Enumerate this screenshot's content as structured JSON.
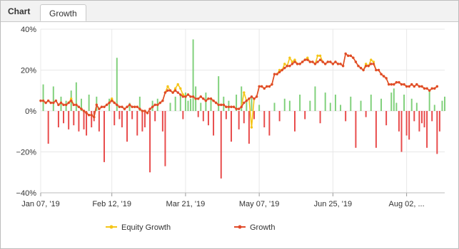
{
  "header": {
    "title": "Chart",
    "tabs": [
      {
        "label": "Growth",
        "active": true
      }
    ]
  },
  "colors": {
    "growth": "#e04a2a",
    "equity": "#f5c518",
    "profit_bar": "#7fd07a",
    "loss_bar": "#e84a4a",
    "grid": "#e8e8e8"
  },
  "chart_data": {
    "type": "line",
    "title": "",
    "xlabel": "",
    "ylabel": "",
    "x_ticks": [
      "Jan 07, '19",
      "Feb 12, '19",
      "Mar 21, '19",
      "May 07, '19",
      "Jun 25, '19",
      "Aug 02, ..."
    ],
    "y_ticks": [
      "40%",
      "20%",
      "0%",
      "−20%",
      "−40%"
    ],
    "ylim": [
      -40,
      40
    ],
    "x_unit": "trading day index",
    "xlim": [
      0,
      159
    ],
    "x_tick_positions": [
      0,
      28,
      57,
      86,
      115,
      144
    ],
    "legend": {
      "position": "bottom",
      "entries": [
        "Equity Growth",
        "Growth"
      ]
    },
    "series": [
      {
        "name": "Growth",
        "values": [
          5,
          5,
          4,
          5,
          4,
          4,
          5,
          3,
          4,
          3,
          3,
          4,
          5,
          3,
          3,
          2,
          1,
          0,
          -1,
          -2,
          -2,
          -3,
          3,
          1,
          2,
          2,
          3,
          4,
          5,
          4,
          3,
          2,
          2,
          1,
          2,
          3,
          2,
          2,
          2,
          1,
          0,
          0,
          -1,
          1,
          2,
          3,
          3,
          4,
          5,
          9,
          10,
          10,
          9,
          10,
          9,
          8,
          7,
          7,
          8,
          7,
          7,
          6,
          6,
          7,
          6,
          5,
          6,
          6,
          5,
          4,
          3,
          3,
          3,
          2,
          2,
          2,
          2,
          1,
          1,
          2,
          4,
          5,
          6,
          7,
          6,
          7,
          12,
          12,
          11,
          12,
          12,
          13,
          18,
          18,
          19,
          20,
          21,
          22,
          22,
          23,
          24,
          23,
          23,
          24,
          25,
          25,
          24,
          24,
          23,
          24,
          25,
          24,
          23,
          24,
          24,
          23,
          24,
          23,
          23,
          22,
          28,
          27,
          27,
          26,
          24,
          22,
          21,
          20,
          22,
          22,
          23,
          23,
          20,
          20,
          18,
          17,
          16,
          13,
          13,
          13,
          14,
          14,
          13,
          13,
          12,
          12,
          13,
          12,
          13,
          12,
          12,
          11,
          11,
          10,
          11,
          11,
          12
        ]
      },
      {
        "name": "Equity Growth",
        "values": [
          5,
          5,
          4,
          5,
          4,
          4,
          5,
          3,
          4,
          3,
          3,
          4,
          6,
          3,
          3,
          2,
          1,
          0,
          -1,
          -2,
          -2,
          -3,
          3,
          1,
          2,
          2,
          3,
          4,
          6,
          4,
          3,
          2,
          2,
          1,
          2,
          3,
          2,
          2,
          2,
          1,
          0,
          0,
          -1,
          1,
          2,
          3,
          3,
          4,
          5,
          9,
          12,
          10,
          9,
          11,
          13,
          11,
          8,
          7,
          8,
          7,
          7,
          6,
          6,
          7,
          6,
          5,
          6,
          6,
          5,
          4,
          3,
          3,
          3,
          2,
          2,
          2,
          2,
          1,
          1,
          2,
          9,
          5,
          6,
          -8,
          6,
          7,
          12,
          12,
          11,
          12,
          12,
          13,
          18,
          18,
          20,
          20,
          23,
          22,
          26,
          24,
          25,
          23,
          23,
          24,
          25,
          26,
          24,
          24,
          23,
          27,
          27,
          24,
          23,
          24,
          24,
          23,
          24,
          23,
          23,
          22,
          28,
          27,
          27,
          26,
          24,
          22,
          21,
          20,
          23,
          22,
          25,
          24,
          20,
          20,
          18,
          17,
          16,
          13,
          13,
          13,
          14,
          14,
          13,
          13,
          12,
          12,
          13,
          12,
          13,
          12,
          12,
          11,
          11,
          10,
          11,
          11,
          12
        ]
      }
    ],
    "bars": [
      {
        "x": 1,
        "value": 13
      },
      {
        "x": 3,
        "value": -16
      },
      {
        "x": 5,
        "value": 12
      },
      {
        "x": 7,
        "value": -8
      },
      {
        "x": 8,
        "value": 7
      },
      {
        "x": 9,
        "value": -6
      },
      {
        "x": 10,
        "value": 5
      },
      {
        "x": 11,
        "value": -9
      },
      {
        "x": 12,
        "value": 10
      },
      {
        "x": 13,
        "value": -7
      },
      {
        "x": 14,
        "value": 14
      },
      {
        "x": 15,
        "value": -10
      },
      {
        "x": 16,
        "value": 6
      },
      {
        "x": 17,
        "value": -9
      },
      {
        "x": 18,
        "value": -12
      },
      {
        "x": 19,
        "value": 8
      },
      {
        "x": 20,
        "value": -8
      },
      {
        "x": 21,
        "value": -5
      },
      {
        "x": 22,
        "value": 7
      },
      {
        "x": 23,
        "value": -10
      },
      {
        "x": 25,
        "value": -25
      },
      {
        "x": 27,
        "value": 6
      },
      {
        "x": 29,
        "value": -7
      },
      {
        "x": 30,
        "value": 26
      },
      {
        "x": 31,
        "value": -4
      },
      {
        "x": 32,
        "value": -8
      },
      {
        "x": 34,
        "value": -15
      },
      {
        "x": 35,
        "value": 4
      },
      {
        "x": 36,
        "value": -4
      },
      {
        "x": 38,
        "value": -12
      },
      {
        "x": 39,
        "value": 7
      },
      {
        "x": 40,
        "value": -10
      },
      {
        "x": 41,
        "value": -8
      },
      {
        "x": 43,
        "value": -30
      },
      {
        "x": 44,
        "value": 5
      },
      {
        "x": 45,
        "value": -5
      },
      {
        "x": 46,
        "value": 6
      },
      {
        "x": 48,
        "value": -10
      },
      {
        "x": 49,
        "value": -27
      },
      {
        "x": 51,
        "value": 4
      },
      {
        "x": 53,
        "value": 7
      },
      {
        "x": 55,
        "value": 8
      },
      {
        "x": 56,
        "value": -4
      },
      {
        "x": 57,
        "value": 9
      },
      {
        "x": 58,
        "value": 5
      },
      {
        "x": 59,
        "value": 6
      },
      {
        "x": 60,
        "value": 35
      },
      {
        "x": 61,
        "value": 12
      },
      {
        "x": 62,
        "value": -3
      },
      {
        "x": 63,
        "value": 4
      },
      {
        "x": 64,
        "value": -5
      },
      {
        "x": 65,
        "value": 9
      },
      {
        "x": 66,
        "value": -7
      },
      {
        "x": 67,
        "value": 6
      },
      {
        "x": 68,
        "value": -12
      },
      {
        "x": 70,
        "value": 17
      },
      {
        "x": 71,
        "value": -33
      },
      {
        "x": 72,
        "value": 7
      },
      {
        "x": 73,
        "value": -4
      },
      {
        "x": 74,
        "value": 5
      },
      {
        "x": 75,
        "value": -15
      },
      {
        "x": 77,
        "value": 8
      },
      {
        "x": 78,
        "value": -9
      },
      {
        "x": 79,
        "value": 12
      },
      {
        "x": 80,
        "value": -6
      },
      {
        "x": 81,
        "value": 5
      },
      {
        "x": 82,
        "value": -16
      },
      {
        "x": 83,
        "value": 7
      },
      {
        "x": 84,
        "value": -4
      },
      {
        "x": 86,
        "value": 3
      },
      {
        "x": 88,
        "value": -8
      },
      {
        "x": 90,
        "value": -12
      },
      {
        "x": 92,
        "value": 4
      },
      {
        "x": 94,
        "value": -5
      },
      {
        "x": 96,
        "value": 6
      },
      {
        "x": 98,
        "value": 5
      },
      {
        "x": 100,
        "value": -10
      },
      {
        "x": 102,
        "value": 8
      },
      {
        "x": 104,
        "value": -4
      },
      {
        "x": 106,
        "value": 5
      },
      {
        "x": 108,
        "value": 12
      },
      {
        "x": 110,
        "value": -6
      },
      {
        "x": 112,
        "value": 9
      },
      {
        "x": 114,
        "value": 4
      },
      {
        "x": 116,
        "value": 8
      },
      {
        "x": 118,
        "value": 3
      },
      {
        "x": 120,
        "value": -5
      },
      {
        "x": 122,
        "value": 7
      },
      {
        "x": 124,
        "value": -18
      },
      {
        "x": 126,
        "value": 5
      },
      {
        "x": 128,
        "value": -3
      },
      {
        "x": 130,
        "value": 8
      },
      {
        "x": 132,
        "value": -18
      },
      {
        "x": 134,
        "value": 6
      },
      {
        "x": 136,
        "value": -7
      },
      {
        "x": 138,
        "value": 9
      },
      {
        "x": 139,
        "value": 11
      },
      {
        "x": 140,
        "value": 4
      },
      {
        "x": 141,
        "value": -10
      },
      {
        "x": 142,
        "value": -20
      },
      {
        "x": 143,
        "value": 8
      },
      {
        "x": 144,
        "value": -12
      },
      {
        "x": 145,
        "value": -14
      },
      {
        "x": 146,
        "value": 6
      },
      {
        "x": 147,
        "value": -5
      },
      {
        "x": 148,
        "value": 4
      },
      {
        "x": 149,
        "value": -10
      },
      {
        "x": 150,
        "value": -6
      },
      {
        "x": 151,
        "value": -8
      },
      {
        "x": 152,
        "value": -18
      },
      {
        "x": 153,
        "value": 10
      },
      {
        "x": 154,
        "value": -5
      },
      {
        "x": 155,
        "value": 3
      },
      {
        "x": 156,
        "value": -21
      },
      {
        "x": 157,
        "value": -10
      },
      {
        "x": 158,
        "value": 5
      },
      {
        "x": 159,
        "value": 7
      }
    ]
  }
}
